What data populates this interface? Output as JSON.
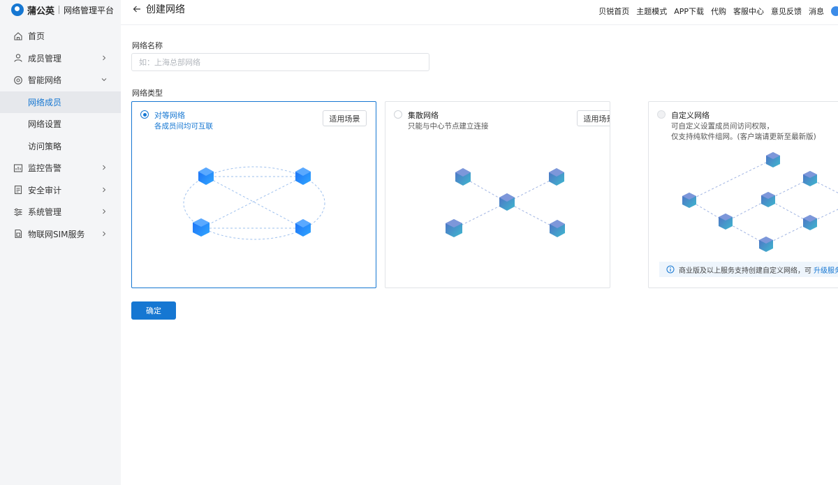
{
  "brand": {
    "name": "蒲公英",
    "subtitle": "网络管理平台"
  },
  "sidebar": {
    "items": [
      {
        "label": "首页",
        "icon": "home-icon"
      },
      {
        "label": "成员管理",
        "icon": "user-icon"
      },
      {
        "label": "智能网络",
        "icon": "network-icon"
      },
      {
        "label": "网络成员"
      },
      {
        "label": "网络设置"
      },
      {
        "label": "访问策略"
      },
      {
        "label": "监控告警",
        "icon": "monitor-icon"
      },
      {
        "label": "安全审计",
        "icon": "audit-icon"
      },
      {
        "label": "系统管理",
        "icon": "settings-icon"
      },
      {
        "label": "物联网SIM服务",
        "icon": "sim-icon"
      }
    ]
  },
  "header": {
    "title": "创建网络",
    "links": [
      "贝锐首页",
      "主题模式",
      "APP下载",
      "代购",
      "客服中心",
      "意见反馈",
      "消息"
    ]
  },
  "form": {
    "name_label": "网络名称",
    "name_placeholder": "如：上海总部网络",
    "name_value": "",
    "type_label": "网络类型",
    "confirm_label": "确定"
  },
  "network_types": [
    {
      "title": "对等网络",
      "desc": "各成员间均可互联",
      "button": "适用场景",
      "selected": true
    },
    {
      "title": "集散网络",
      "desc": "只能与中心节点建立连接",
      "button": "适用场景",
      "selected": false
    },
    {
      "title": "自定义网络",
      "desc_lines": [
        "可自定义设置成员间访问权限，",
        "仅支持纯软件组网。(客户端请更新至最新版)"
      ],
      "selected": false,
      "disabled": true,
      "notice": "商业版及以上服务支持创建自定义网络，可",
      "notice_link": "升级服务"
    }
  ],
  "colors": {
    "accent": "#1677d2",
    "sidebar_bg": "#f4f5f7",
    "active_sub_bg": "#e6e8ec"
  }
}
